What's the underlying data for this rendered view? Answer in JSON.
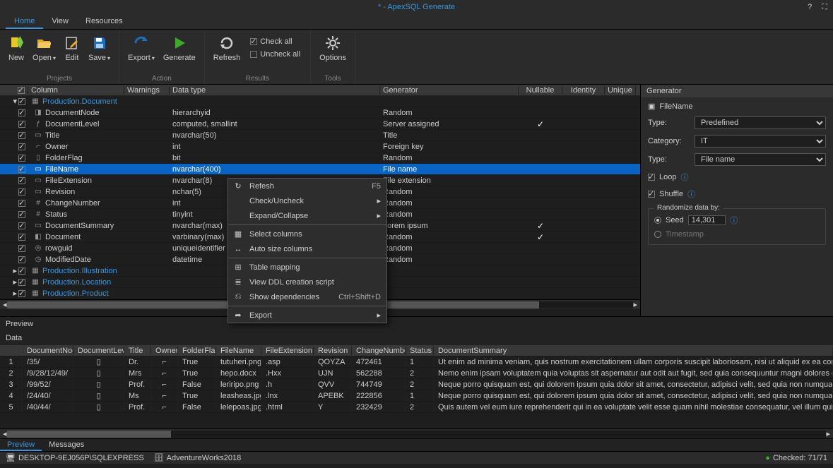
{
  "app_title": "* - ApexSQL Generate",
  "menus": {
    "home": "Home",
    "view": "View",
    "resources": "Resources"
  },
  "ribbon": {
    "new": "New",
    "open": "Open",
    "edit": "Edit",
    "save": "Save",
    "export": "Export",
    "generate": "Generate",
    "refresh": "Refresh",
    "check_all": "Check all",
    "uncheck_all": "Uncheck all",
    "options": "Options",
    "group_projects": "Projects",
    "group_action": "Action",
    "group_results": "Results",
    "group_tools": "Tools"
  },
  "grid": {
    "headers": {
      "column": "Column",
      "warnings": "Warnings",
      "data_type": "Data type",
      "generator": "Generator",
      "nullable": "Nullable",
      "identity": "Identity",
      "unique": "Unique"
    },
    "tables": [
      {
        "name": "Production.Document",
        "expanded": true,
        "rows": [
          {
            "icon": "hier",
            "name": "DocumentNode",
            "dt": "hierarchyid",
            "gen": "Random"
          },
          {
            "icon": "calc",
            "name": "DocumentLevel",
            "dt": "computed, smallint",
            "gen": "Server assigned",
            "nullable": true
          },
          {
            "icon": "txt",
            "name": "Title",
            "dt": "nvarchar(50)",
            "gen": "Title"
          },
          {
            "icon": "key",
            "name": "Owner",
            "dt": "int",
            "gen": "Foreign key"
          },
          {
            "icon": "fld",
            "name": "FolderFlag",
            "dt": "bit",
            "gen": "Random"
          },
          {
            "icon": "txt",
            "name": "FileName",
            "dt": "nvarchar(400)",
            "gen": "File name",
            "selected": true
          },
          {
            "icon": "txt",
            "name": "FileExtension",
            "dt": "nvarchar(8)",
            "gen": "File extension"
          },
          {
            "icon": "txt",
            "name": "Revision",
            "dt": "nchar(5)",
            "gen": "Random"
          },
          {
            "icon": "num",
            "name": "ChangeNumber",
            "dt": "int",
            "gen": "Random"
          },
          {
            "icon": "num",
            "name": "Status",
            "dt": "tinyint",
            "gen": "Random"
          },
          {
            "icon": "txt",
            "name": "DocumentSummary",
            "dt": "nvarchar(max)",
            "gen": "Lorem ipsum",
            "nullable": true
          },
          {
            "icon": "bin",
            "name": "Document",
            "dt": "varbinary(max)",
            "gen": "Random",
            "nullable": true
          },
          {
            "icon": "gid",
            "name": "rowguid",
            "dt": "uniqueidentifier",
            "gen": "Random"
          },
          {
            "icon": "dt",
            "name": "ModifiedDate",
            "dt": "datetime",
            "gen": "Random"
          }
        ]
      },
      {
        "name": "Production.Illustration",
        "expanded": false
      },
      {
        "name": "Production.Location",
        "expanded": false
      },
      {
        "name": "Production.Product",
        "expanded": false
      }
    ]
  },
  "context_menu": [
    {
      "icon": "↻",
      "label": "Refesh",
      "hotkey": "F5"
    },
    {
      "label": "Check/Uncheck",
      "submenu": true
    },
    {
      "label": "Expand/Collapse",
      "submenu": true
    },
    {
      "sep": true
    },
    {
      "icon": "▦",
      "label": "Select columns"
    },
    {
      "icon": "↔",
      "label": "Auto size columns"
    },
    {
      "sep": true
    },
    {
      "icon": "⊞",
      "label": "Table mapping"
    },
    {
      "icon": "≣",
      "label": "View DDL creation script"
    },
    {
      "icon": "⎌",
      "label": "Show dependencies",
      "hotkey": "Ctrl+Shift+D"
    },
    {
      "sep": true
    },
    {
      "icon": "➦",
      "label": "Export",
      "submenu": true
    }
  ],
  "sidepanel": {
    "title": "Generator",
    "field_icon": "▣",
    "field": "FileName",
    "type_label": "Type:",
    "type_value": "Predefined",
    "category_label": "Category:",
    "category_value": "IT",
    "subtype_label": "Type:",
    "subtype_value": "File name",
    "loop": "Loop",
    "shuffle": "Shuffle",
    "randomize_legend": "Randomize data by:",
    "seed_label": "Seed",
    "seed_value": "14,301",
    "timestamp_label": "Timestamp"
  },
  "preview": {
    "title": "Preview",
    "sub": "Data",
    "headers": {
      "dn": "DocumentNode",
      "dl": "DocumentLevel",
      "ti": "Title",
      "ow": "Owner",
      "ff": "FolderFlag",
      "fn": "FileName",
      "fe": "FileExtension",
      "rv": "Revision",
      "cn": "ChangeNumber",
      "st": "Status",
      "ds": "DocumentSummary"
    },
    "rows": [
      {
        "idx": "1",
        "dn": "/35/",
        "ti": "Dr.",
        "ff": "True",
        "fn": "tutuheri.png",
        "fe": ".asp",
        "rv": "QOYZA",
        "cn": "472461",
        "st": "1",
        "ds": "Ut enim ad minima veniam, quis nostrum exercitationem ullam corporis suscipit laboriosam, nisi ut aliquid ex ea commodi consequatur?"
      },
      {
        "idx": "2",
        "dn": "/9/28/12/49/",
        "ti": "Mrs",
        "ff": "True",
        "fn": "hepo.docx",
        "fe": ".Hxx",
        "rv": "UJN",
        "cn": "562288",
        "st": "2",
        "ds": "Nemo enim ipsam voluptatem quia voluptas sit aspernatur aut odit aut fugit, sed quia consequuntur magni dolores eos qui ratione volu"
      },
      {
        "idx": "3",
        "dn": "/99/52/",
        "ti": "Prof.",
        "ff": "False",
        "fn": "leriripo.png",
        "fe": ".h",
        "rv": "QVV",
        "cn": "744749",
        "st": "2",
        "ds": "Neque porro quisquam est, qui dolorem ipsum quia dolor sit amet, consectetur, adipisci velit, sed quia non numquam eius modi tempora"
      },
      {
        "idx": "4",
        "dn": "/24/40/",
        "ti": "Ms",
        "ff": "True",
        "fn": "leasheas.jpg",
        "fe": ".lnx",
        "rv": "APEBK",
        "cn": "222856",
        "st": "1",
        "ds": "Neque porro quisquam est, qui dolorem ipsum quia dolor sit amet, consectetur, adipisci velit, sed quia non numquam eius modi tempora"
      },
      {
        "idx": "5",
        "dn": "/40/44/",
        "ti": "Prof.",
        "ff": "False",
        "fn": "lelepoas.jpg",
        "fe": ".html",
        "rv": "Y",
        "cn": "232429",
        "st": "2",
        "ds": "Quis autem vel eum iure reprehenderit qui in ea voluptate velit esse quam nihil molestiae consequatur, vel illum qui dolorem eum fugiat"
      }
    ]
  },
  "tabs": {
    "preview": "Preview",
    "messages": "Messages"
  },
  "status": {
    "server": "DESKTOP-9EJ056P\\SQLEXPRESS",
    "db": "AdventureWorks2018",
    "checked": "Checked: 71/71"
  }
}
